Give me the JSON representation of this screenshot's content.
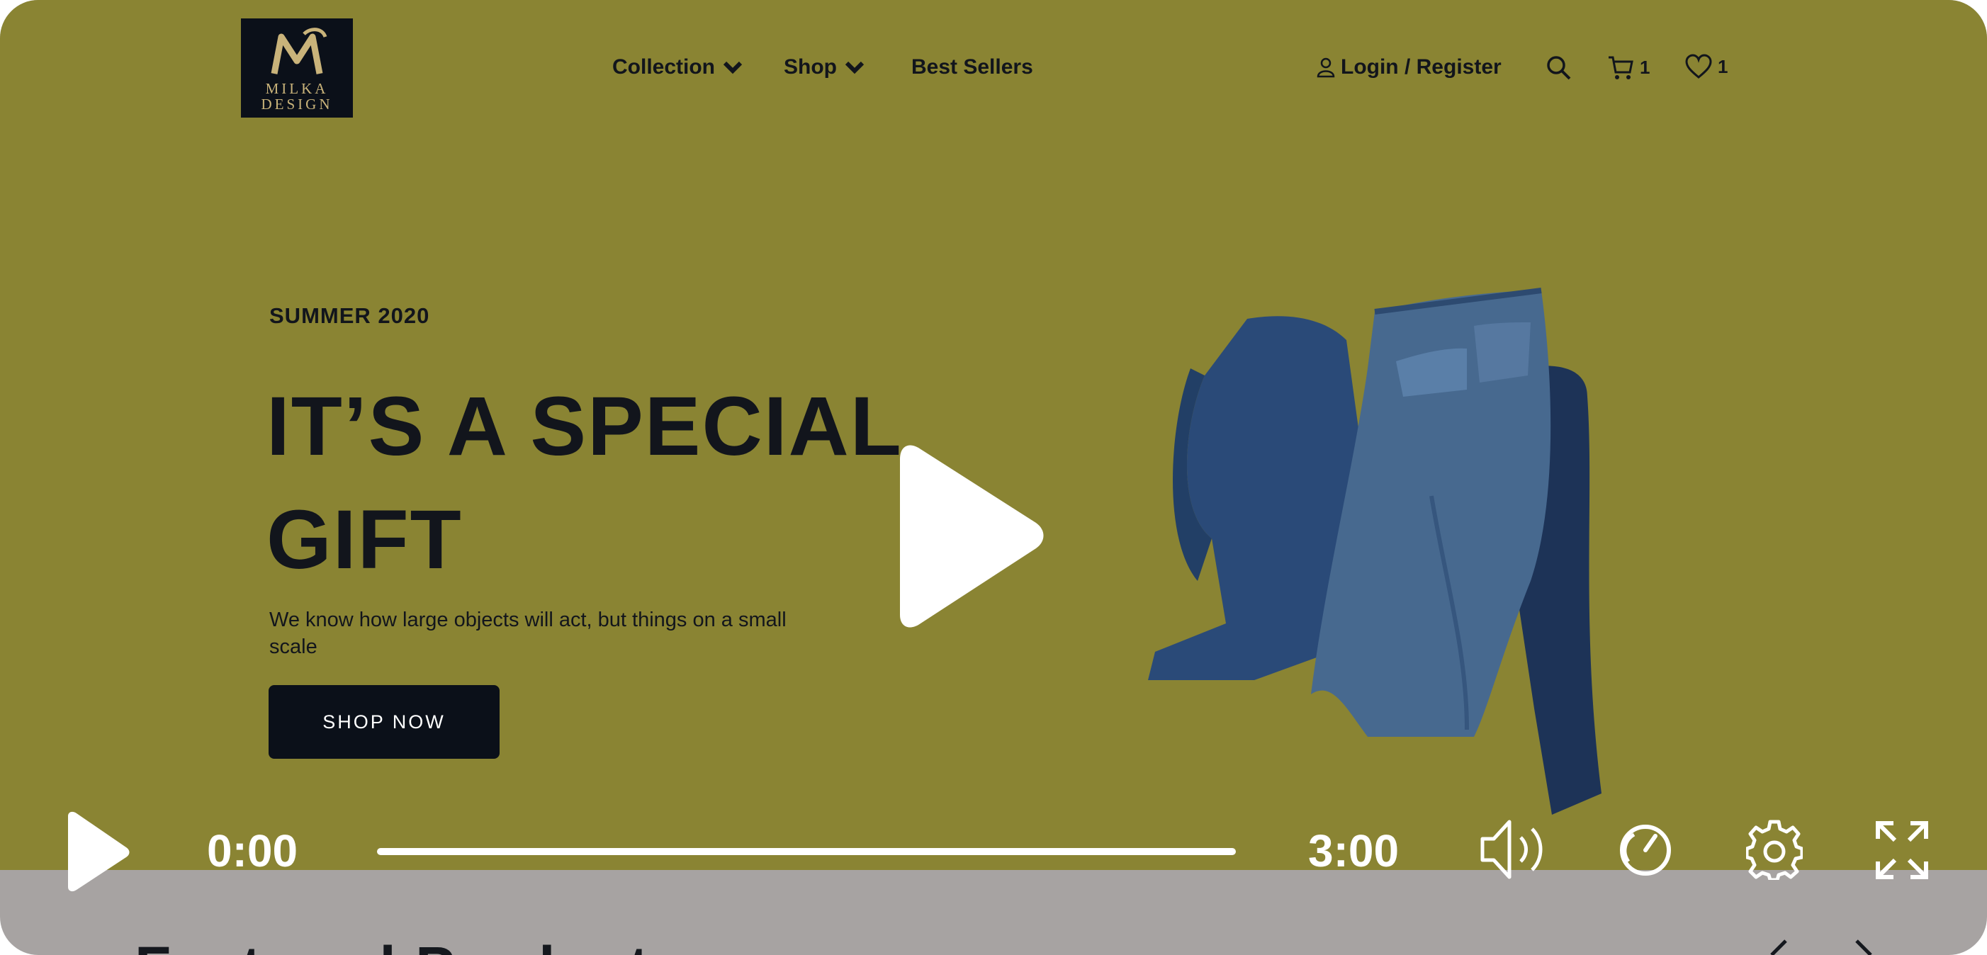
{
  "brand": {
    "logo_line1": "MILKA",
    "logo_line2": "DESIGN"
  },
  "nav": {
    "items": [
      {
        "label": "Collection",
        "has_dropdown": true
      },
      {
        "label": "Shop",
        "has_dropdown": true
      },
      {
        "label": "Best Sellers",
        "has_dropdown": false
      }
    ]
  },
  "header_actions": {
    "account_label": "Login / Register",
    "cart_count": "1",
    "wishlist_count": "1",
    "icons": [
      "user-icon",
      "search-icon",
      "cart-icon",
      "heart-icon"
    ]
  },
  "hero": {
    "eyebrow": "SUMMER 2020",
    "headline_line1": "IT’S A SPECIAL",
    "headline_line2": "GIFT",
    "subtext": "We know how large objects will act, but things on a small scale",
    "cta_label": "SHOP NOW"
  },
  "player": {
    "current_time": "0:00",
    "duration": "3:00",
    "progress": 0,
    "icons": [
      "play-icon",
      "volume-icon",
      "speed-icon",
      "settings-icon",
      "fullscreen-icon"
    ]
  },
  "below": {
    "section_title": "Featured Products"
  },
  "colors": {
    "hero_bg": "#8a8433",
    "dark": "#0b1019",
    "page_bg": "#a7a3a2",
    "accent_gold": "#c9b37a"
  }
}
